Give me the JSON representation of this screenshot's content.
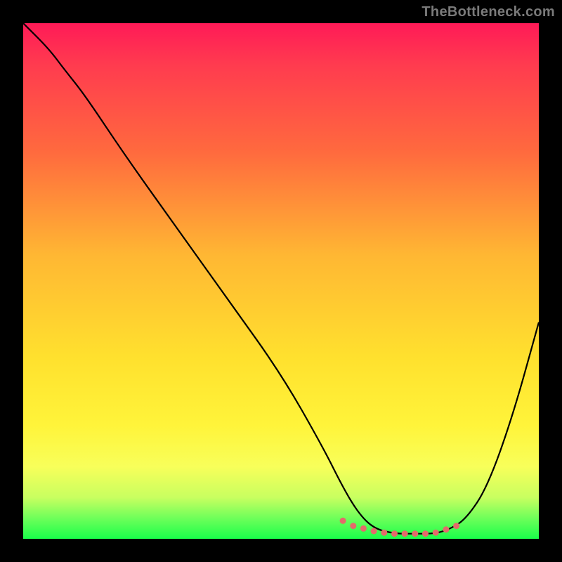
{
  "watermark": "TheBottleneck.com",
  "chart_data": {
    "type": "line",
    "title": "",
    "xlabel": "",
    "ylabel": "",
    "xlim": [
      0,
      100
    ],
    "ylim": [
      0,
      100
    ],
    "background_gradient": {
      "top": "#ff1a57",
      "middle": "#ffe12e",
      "bottom": "#1aff4a"
    },
    "series": [
      {
        "name": "bottleneck-curve",
        "color": "#000000",
        "x": [
          0,
          5,
          8,
          12,
          20,
          30,
          40,
          50,
          58,
          62,
          65,
          68,
          72,
          76,
          80,
          83,
          86,
          90,
          95,
          100
        ],
        "values": [
          100,
          95,
          91,
          86,
          74,
          60,
          46,
          32,
          18,
          10,
          5,
          2,
          1,
          1,
          1,
          2,
          4,
          10,
          24,
          42
        ]
      },
      {
        "name": "highlighted-minimum-dots",
        "color": "#e46a6a",
        "type": "scatter",
        "x": [
          62,
          64,
          66,
          68,
          70,
          72,
          74,
          76,
          78,
          80,
          82,
          84
        ],
        "values": [
          3.5,
          2.5,
          2,
          1.5,
          1.2,
          1,
          1,
          1,
          1,
          1.2,
          1.8,
          2.5
        ]
      }
    ],
    "grid": false,
    "legend": false
  }
}
